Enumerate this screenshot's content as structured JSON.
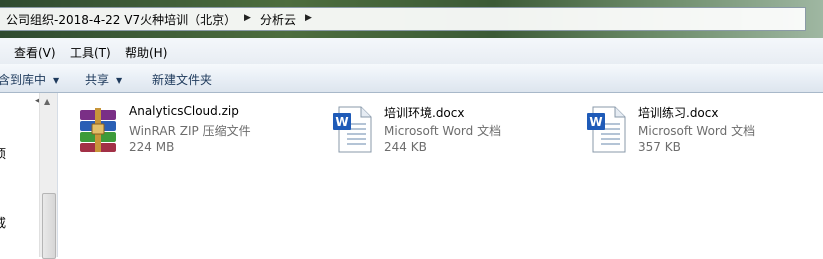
{
  "address": {
    "crumbs": [
      "公司组织-2018-4-22 V7火种培训（北京）",
      "分析云"
    ],
    "separator": "▶"
  },
  "menu": [
    "查看(V)",
    "工具(T)",
    "帮助(H)"
  ],
  "toolbar": {
    "include_library": "含到库中",
    "share": "共享",
    "new_folder": "新建文件夹"
  },
  "nav": {
    "partial_labels": [
      "项",
      "戒"
    ]
  },
  "files": [
    {
      "name": "AnalyticsCloud.zip",
      "type": "WinRAR ZIP 压缩文件",
      "size": "224 MB",
      "icon": "winrar-archive-icon"
    },
    {
      "name": "培训环境.docx",
      "type": "Microsoft Word 文档",
      "size": "244 KB",
      "icon": "word-document-icon"
    },
    {
      "name": "培训练习.docx",
      "type": "Microsoft Word 文档",
      "size": "357 KB",
      "icon": "word-document-icon"
    }
  ]
}
